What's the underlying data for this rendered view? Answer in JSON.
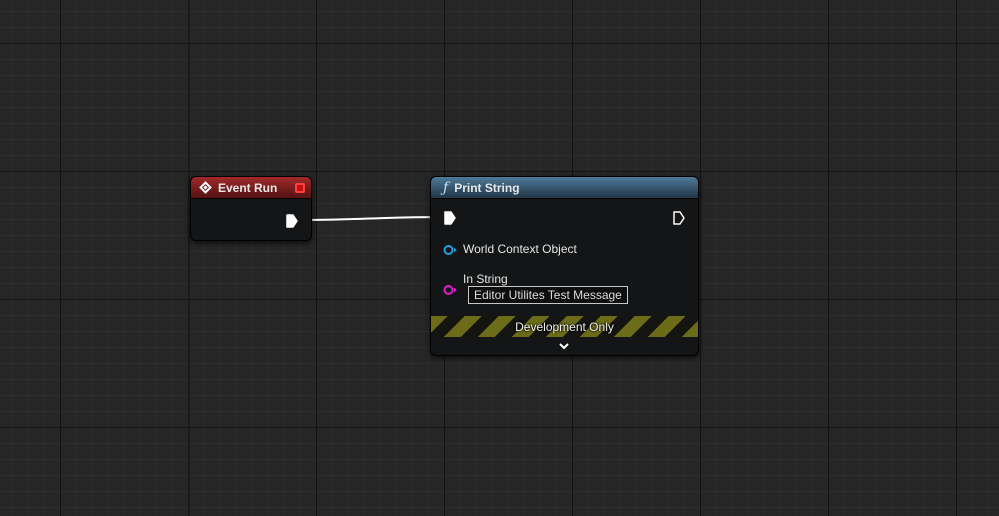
{
  "nodes": {
    "event": {
      "title": "Event Run",
      "icon": "event-diamond-icon",
      "header_color": "#8b2020"
    },
    "print_string": {
      "title": "Print String",
      "icon": "function-icon",
      "header_color": "#3f6580",
      "pins": {
        "world_context": "World Context Object",
        "in_string": "In String",
        "in_string_value": "Editor Utilites Test Message"
      },
      "footer_label": "Development Only"
    }
  },
  "colors": {
    "object_pin": "#1fa0e6",
    "string_pin": "#e01ad4",
    "exec_pin": "#ffffff",
    "wire": "#ffffff"
  }
}
